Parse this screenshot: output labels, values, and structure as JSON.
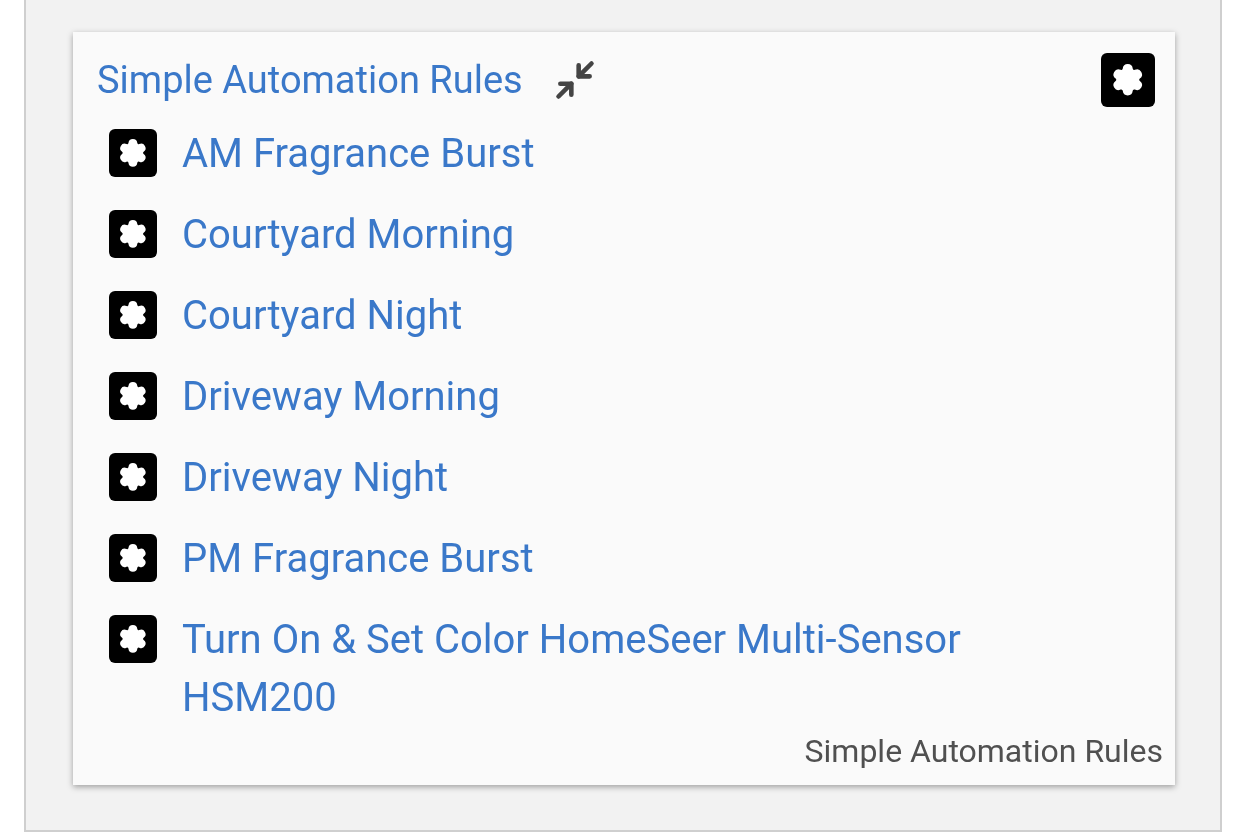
{
  "card": {
    "title": "Simple Automation Rules",
    "footer": "Simple Automation Rules"
  },
  "rules": [
    {
      "label": "AM Fragrance Burst"
    },
    {
      "label": "Courtyard Morning"
    },
    {
      "label": "Courtyard Night"
    },
    {
      "label": "Driveway Morning"
    },
    {
      "label": "Driveway Night"
    },
    {
      "label": "PM Fragrance Burst"
    },
    {
      "label": "Turn On & Set Color HomeSeer Multi-Sensor HSM200"
    }
  ]
}
